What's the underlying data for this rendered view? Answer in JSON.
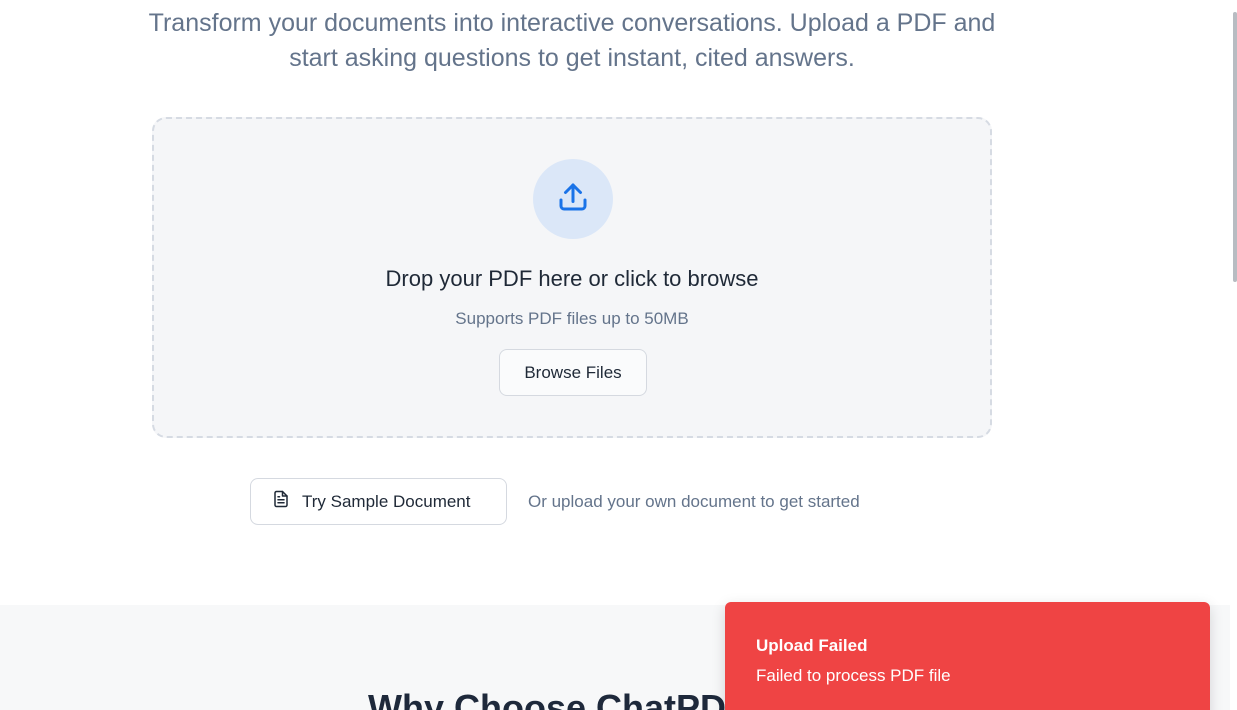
{
  "hero": {
    "subtitle": "Transform your documents into interactive conversations. Upload a PDF and start asking questions to get instant, cited answers."
  },
  "dropzone": {
    "icon": "upload-icon",
    "title": "Drop your PDF here or click to browse",
    "subtitle": "Supports PDF files up to 50MB",
    "browse_label": "Browse Files"
  },
  "sample": {
    "icon": "document-icon",
    "button_label": "Try Sample Document",
    "hint": "Or upload your own document to get started"
  },
  "features": {
    "title": "Why Choose ChatPDF"
  },
  "toast": {
    "title": "Upload Failed",
    "message": "Failed to process PDF file"
  },
  "colors": {
    "accent": "#1a73e8",
    "error": "#ef4444"
  }
}
